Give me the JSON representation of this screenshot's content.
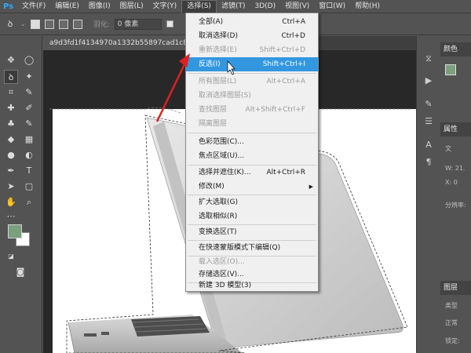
{
  "app": {
    "logo": "Ps"
  },
  "menubar": {
    "items": [
      "文件(F)",
      "编辑(E)",
      "图像(I)",
      "图层(L)",
      "文字(Y)",
      "选择(S)",
      "滤镜(T)",
      "3D(D)",
      "视图(V)",
      "窗口(W)",
      "帮助(H)"
    ]
  },
  "options": {
    "feather_label": "羽化:",
    "feather_value": "0 像素"
  },
  "document": {
    "tab_title": "a9d3fd1f4134970a1332b55897cad1c8a78"
  },
  "select_menu": {
    "items": [
      {
        "label": "全部(A)",
        "shortcut": "Ctrl+A",
        "disabled": false
      },
      {
        "label": "取消选择(D)",
        "shortcut": "Ctrl+D",
        "disabled": false
      },
      {
        "label": "重新选择(E)",
        "shortcut": "Shift+Ctrl+D",
        "disabled": true
      },
      {
        "label": "反选(I)",
        "shortcut": "Shift+Ctrl+I",
        "disabled": false,
        "highlighted": true
      },
      {
        "label": "所有图层(L)",
        "shortcut": "Alt+Ctrl+A",
        "disabled": true
      },
      {
        "label": "取消选择图层(S)",
        "shortcut": "",
        "disabled": true
      },
      {
        "label": "查找图层",
        "shortcut": "Alt+Shift+Ctrl+F",
        "disabled": true
      },
      {
        "label": "隔离图层",
        "shortcut": "",
        "disabled": true
      },
      {
        "label": "色彩范围(C)...",
        "shortcut": "",
        "disabled": false
      },
      {
        "label": "焦点区域(U)...",
        "shortcut": "",
        "disabled": false
      },
      {
        "label": "选择并遮住(K)...",
        "shortcut": "Alt+Ctrl+R",
        "disabled": false
      },
      {
        "label": "修改(M)",
        "shortcut": "",
        "disabled": false,
        "submenu": true
      },
      {
        "label": "扩大选取(G)",
        "shortcut": "",
        "disabled": false
      },
      {
        "label": "选取相似(R)",
        "shortcut": "",
        "disabled": false
      },
      {
        "label": "变换选区(T)",
        "shortcut": "",
        "disabled": false
      },
      {
        "label": "在快速蒙版模式下编辑(Q)",
        "shortcut": "",
        "disabled": false
      },
      {
        "label": "载入选区(O)...",
        "shortcut": "",
        "disabled": true
      },
      {
        "label": "存储选区(V)...",
        "shortcut": "",
        "disabled": false
      },
      {
        "label": "新建 3D 模型(3)",
        "shortcut": "",
        "disabled": false
      }
    ]
  },
  "panels": {
    "color_tab": "颜色",
    "properties_tab": "属性",
    "properties_doc": "文",
    "w_label": "W:",
    "w_value": "21.",
    "x_label": "X:",
    "x_value": "0",
    "resolution_label": "分辨率:",
    "layers_tab": "图层",
    "layers_kind": "类型",
    "layers_mode": "正常",
    "layers_lock": "锁定:"
  },
  "colors": {
    "foreground": "#7aa07d",
    "background": "#ffffff",
    "menu_highlight": "#3397e0",
    "annotation_arrow": "#e02020"
  }
}
